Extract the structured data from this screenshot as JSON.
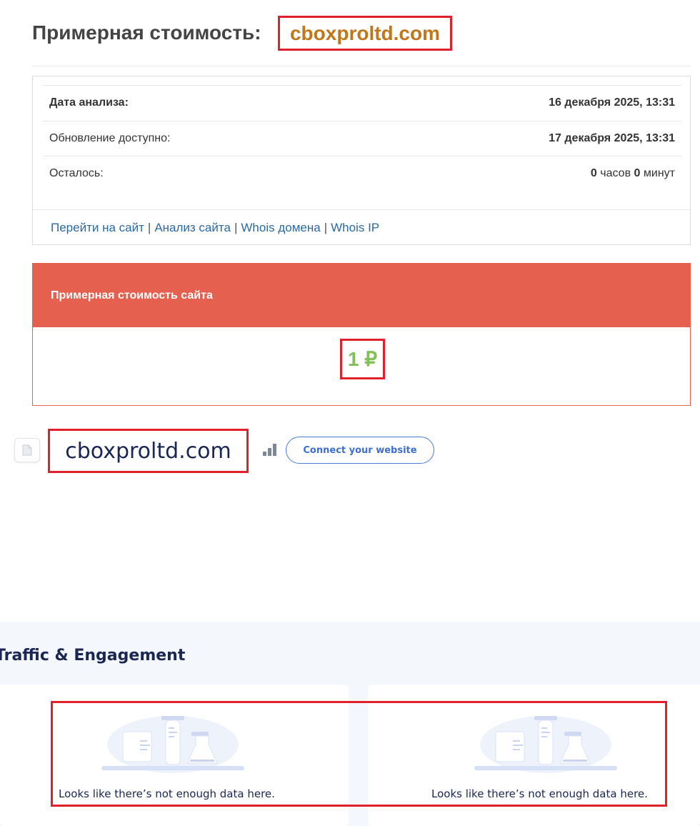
{
  "header": {
    "title_prefix": "Примерная стоимость:",
    "domain": "cboxproltd.com"
  },
  "info": {
    "rows": [
      {
        "label": "Дата анализа:",
        "value": "16 декабря 2025, 13:31"
      },
      {
        "label": "Обновление доступно:",
        "value": "17 декабря 2025, 13:31"
      }
    ],
    "remaining": {
      "label": "Осталось:",
      "hours": "0",
      "hours_unit": "часов",
      "minutes": "0",
      "minutes_unit": "минут"
    },
    "links": {
      "goto_site": "Перейти на сайт",
      "site_analysis": "Анализ сайта",
      "whois_domain": "Whois домена",
      "whois_ip": "Whois IP",
      "separator": "|"
    }
  },
  "cost": {
    "heading": "Примерная стоимость сайта",
    "value": "1 ₽"
  },
  "similarweb": {
    "domain": "cboxproltd.com",
    "connect_label": "Connect your website",
    "section_title": "Traffic & Engagement",
    "cards": [
      {
        "message": "Looks like there’s not enough data here."
      },
      {
        "message": "Looks like there’s not enough data here."
      }
    ]
  },
  "colors": {
    "accent_red": "#e5604f",
    "highlight_red": "#e0202a",
    "domain_orange": "#c0771a",
    "cost_green": "#82c05a",
    "link_blue": "#2c6aa0",
    "navy": "#1b2653"
  },
  "icons": {
    "favicon": "page-icon",
    "rank": "rank-bars-icon"
  }
}
